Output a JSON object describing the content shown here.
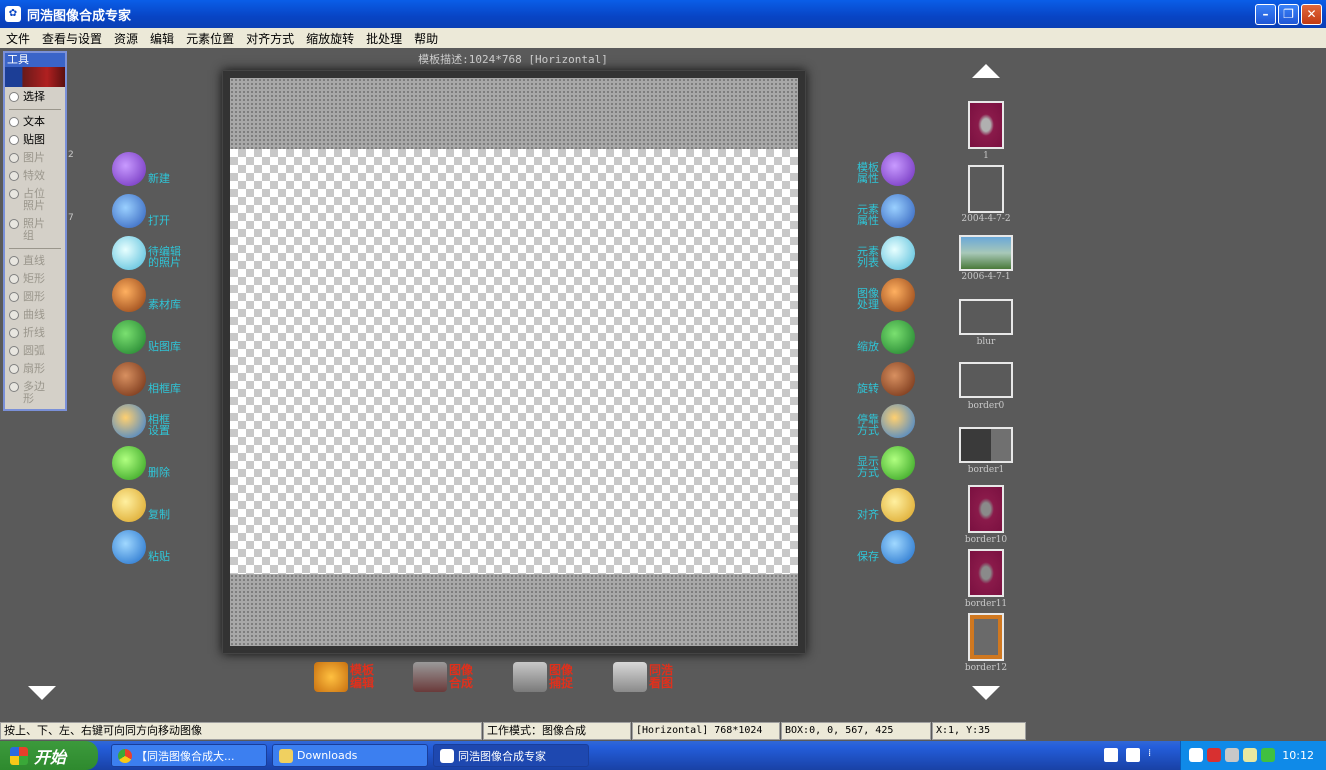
{
  "window": {
    "title": "同浩图像合成专家",
    "app_icon": "palette-icon"
  },
  "menu": [
    "文件",
    "查看与设置",
    "资源",
    "编辑",
    "元素位置",
    "对齐方式",
    "缩放旋转",
    "批处理",
    "帮助"
  ],
  "tools": {
    "title": "工具",
    "items": [
      {
        "label": "选择",
        "enabled": true
      },
      {
        "label": "文本",
        "enabled": true
      },
      {
        "label": "贴图",
        "enabled": true
      },
      {
        "label": "图片",
        "enabled": false
      },
      {
        "label": "特效",
        "enabled": false
      },
      {
        "label": "占位照片",
        "enabled": false
      },
      {
        "label": "照片组",
        "enabled": false
      },
      {
        "label": "直线",
        "enabled": false
      },
      {
        "label": "矩形",
        "enabled": false
      },
      {
        "label": "圆形",
        "enabled": false
      },
      {
        "label": "曲线",
        "enabled": false
      },
      {
        "label": "折线",
        "enabled": false
      },
      {
        "label": "圆弧",
        "enabled": false
      },
      {
        "label": "扇形",
        "enabled": false
      },
      {
        "label": "多边形",
        "enabled": false
      }
    ]
  },
  "side_numbers": [
    "2",
    "7"
  ],
  "template_desc": "模板描述:1024*768 [Horizontal]",
  "left_actions": [
    "新建",
    "打开",
    "待编辑\n的照片",
    "素材库",
    "贴图库",
    "相框库",
    "相框\n设置",
    "删除",
    "复制",
    "粘贴"
  ],
  "right_actions": [
    "模板\n属性",
    "元素\n属性",
    "元素\n列表",
    "图像\n处理",
    "缩放",
    "旋转",
    "停靠\n方式",
    "显示\n方式",
    "对齐",
    "保存"
  ],
  "thumbnails": [
    "1",
    "2004-4-7-2",
    "2006-4-7-1",
    "blur",
    "border0",
    "border1",
    "border10",
    "border11",
    "border12"
  ],
  "bottom_nav": [
    "模板\n编辑",
    "图像\n合成",
    "图像\n捕捉",
    "同浩\n看图"
  ],
  "status": {
    "hint": "按上、下、左、右键可向同方向移动图像",
    "mode": "工作模式：图像合成",
    "orientation": "[Horizontal] 768*1024",
    "box": "BOX:0, 0, 567, 425",
    "coords": "X:1, Y:35"
  },
  "taskbar": {
    "start": "开始",
    "tasks": [
      "【同浩图像合成大...",
      "Downloads",
      "同浩图像合成专家"
    ],
    "clock": "10:12"
  }
}
